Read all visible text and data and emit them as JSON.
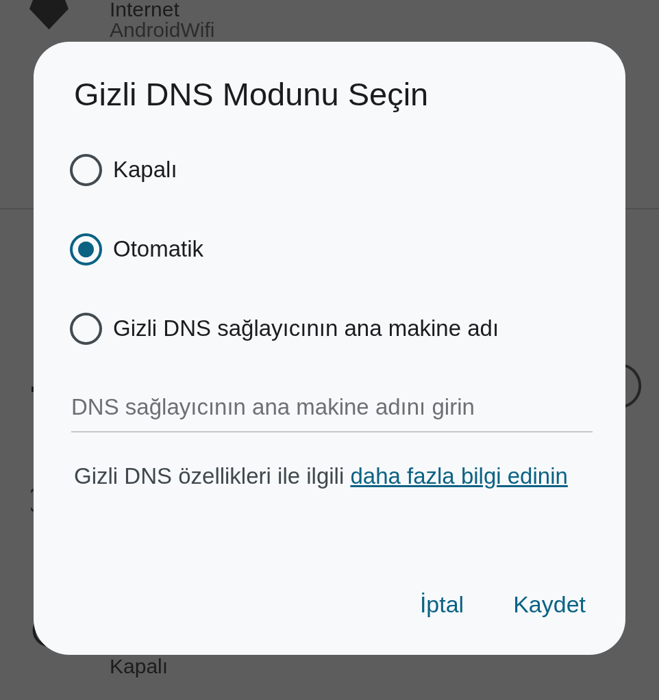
{
  "background": {
    "network": {
      "title": "Internet",
      "subtitle": "AndroidWifi"
    },
    "bottom_item": {
      "label": "Kapalı"
    }
  },
  "dialog": {
    "title": "Gizli DNS Modunu Seçin",
    "options": [
      {
        "label": "Kapalı",
        "selected": false
      },
      {
        "label": "Otomatik",
        "selected": true
      },
      {
        "label": "Gizli DNS sağlayıcının ana makine adı",
        "selected": false
      }
    ],
    "hostname_field": {
      "placeholder": "DNS sağlayıcının ana makine adını girin"
    },
    "info": {
      "text": "Gizli DNS özellikleri ile ilgili",
      "link": "daha fazla bilgi edinin"
    },
    "buttons": [
      {
        "label": "İptal"
      },
      {
        "label": "Kaydet"
      }
    ]
  }
}
